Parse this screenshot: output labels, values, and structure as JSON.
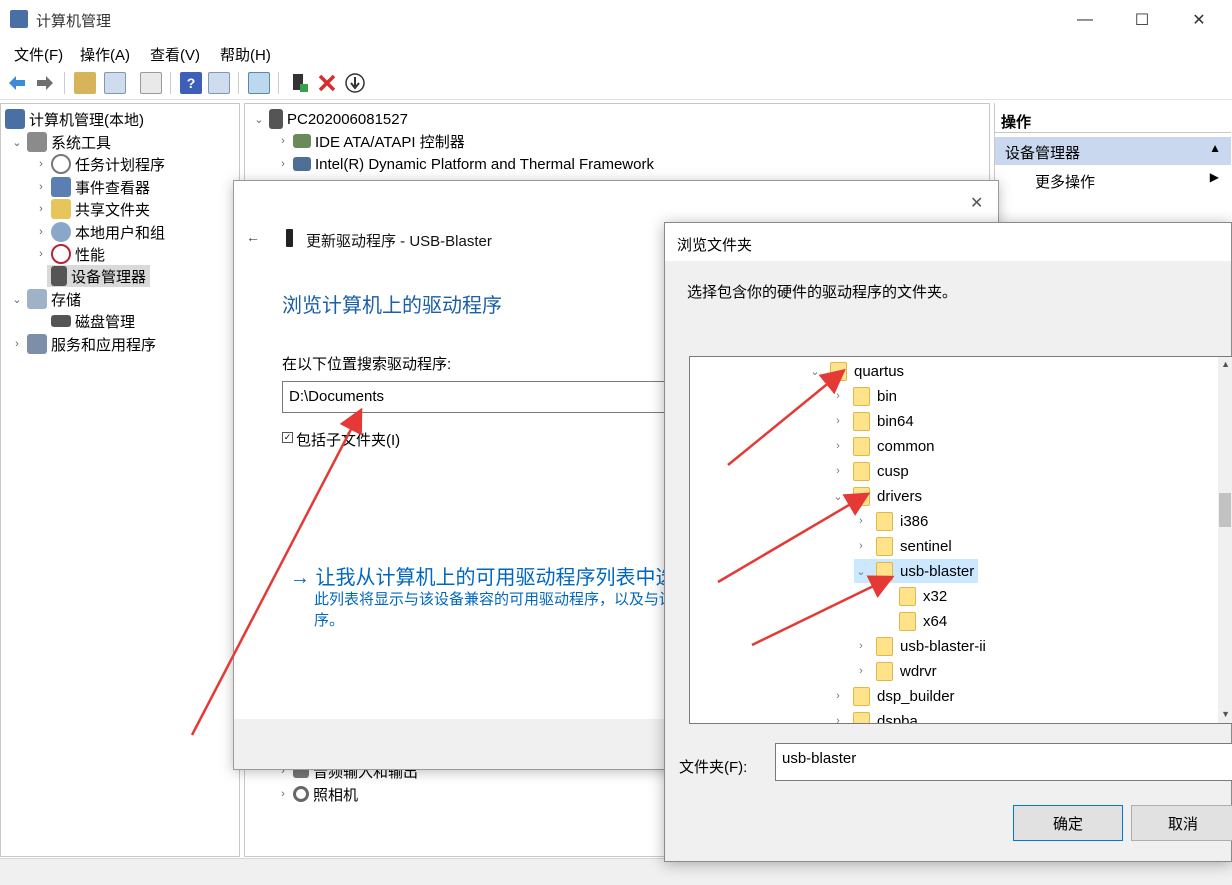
{
  "window": {
    "title": "计算机管理"
  },
  "menu": [
    "文件(F)",
    "操作(A)",
    "查看(V)",
    "帮助(H)"
  ],
  "left_tree": {
    "root": "计算机管理(本地)",
    "system_tools": "系统工具",
    "task_scheduler": "任务计划程序",
    "event_viewer": "事件查看器",
    "shared_folders": "共享文件夹",
    "local_users": "本地用户和组",
    "performance": "性能",
    "device_manager": "设备管理器",
    "storage": "存储",
    "disk_management": "磁盘管理",
    "services": "服务和应用程序"
  },
  "device_tree": {
    "computer": "PC202006081527",
    "items_top": [
      "IDE ATA/ATAPI 控制器",
      "Intel(R) Dynamic Platform and Thermal Framework"
    ],
    "items_bottom": [
      "音频输入和输出",
      "照相机"
    ]
  },
  "actions": {
    "header": "操作",
    "section": "设备管理器",
    "more": "更多操作"
  },
  "update_dialog": {
    "title": "更新驱动程序 - USB-Blaster",
    "heading": "浏览计算机上的驱动程序",
    "search_label": "在以下位置搜索驱动程序:",
    "path_value": "D:\\Documents",
    "include_subfolders": "包括子文件夹(I)",
    "link_text": "→ 让我从计算机上的可用驱动程序列表中选",
    "link_desc_line1": "此列表将显示与该设备兼容的可用驱动程序，以及与设",
    "link_desc_line2": "序。"
  },
  "browse_dialog": {
    "title": "浏览文件夹",
    "instruction": "选择包含你的硬件的驱动程序的文件夹。",
    "folders": [
      {
        "name": "quartus",
        "level": 0,
        "expanded": true
      },
      {
        "name": "bin",
        "level": 1
      },
      {
        "name": "bin64",
        "level": 1
      },
      {
        "name": "common",
        "level": 1
      },
      {
        "name": "cusp",
        "level": 1
      },
      {
        "name": "drivers",
        "level": 1,
        "expanded": true
      },
      {
        "name": "i386",
        "level": 2
      },
      {
        "name": "sentinel",
        "level": 2
      },
      {
        "name": "usb-blaster",
        "level": 2,
        "expanded": true,
        "selected": true
      },
      {
        "name": "x32",
        "level": 3
      },
      {
        "name": "x64",
        "level": 3
      },
      {
        "name": "usb-blaster-ii",
        "level": 2
      },
      {
        "name": "wdrvr",
        "level": 2
      },
      {
        "name": "dsp_builder",
        "level": 1
      },
      {
        "name": "dspba",
        "level": 1
      }
    ],
    "folder_label": "文件夹(F):",
    "folder_value": "usb-blaster",
    "ok": "确定",
    "cancel": "取消"
  },
  "colors": {
    "accent": "#0066cc",
    "link": "#0067c0",
    "arrow": "#e53935",
    "selection": "#cce8ff",
    "folder": "#ffe38a"
  }
}
